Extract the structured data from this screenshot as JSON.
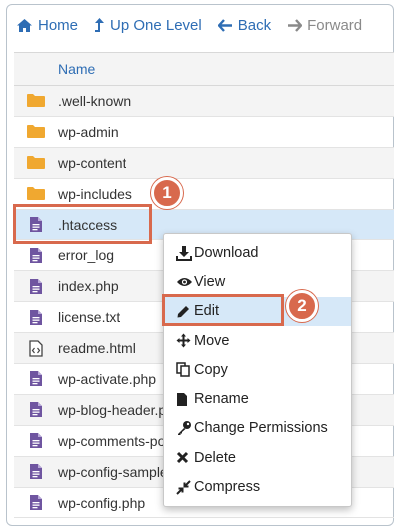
{
  "toolbar": {
    "buttons": [
      {
        "label": "Home",
        "icon": "home-icon"
      },
      {
        "label": "Up One Level",
        "icon": "level-up-icon"
      },
      {
        "label": "Back",
        "icon": "arrow-left-icon"
      },
      {
        "label": "Forward",
        "icon": "arrow-right-icon",
        "disabled": true
      }
    ]
  },
  "file_list": {
    "column_header": "Name",
    "rows": [
      {
        "name": ".well-known",
        "type": "folder"
      },
      {
        "name": "wp-admin",
        "type": "folder"
      },
      {
        "name": "wp-content",
        "type": "folder"
      },
      {
        "name": "wp-includes",
        "type": "folder"
      },
      {
        "name": ".htaccess",
        "type": "text",
        "selected": true
      },
      {
        "name": "error_log",
        "type": "text"
      },
      {
        "name": "index.php",
        "type": "text"
      },
      {
        "name": "license.txt",
        "type": "text"
      },
      {
        "name": "readme.html",
        "type": "code"
      },
      {
        "name": "wp-activate.php",
        "type": "text"
      },
      {
        "name": "wp-blog-header.php",
        "type": "text"
      },
      {
        "name": "wp-comments-post.php",
        "type": "text"
      },
      {
        "name": "wp-config-sample.php",
        "type": "text"
      },
      {
        "name": "wp-config.php",
        "type": "text"
      }
    ]
  },
  "context_menu": {
    "items": [
      {
        "label": "Download",
        "icon": "download-icon"
      },
      {
        "label": "View",
        "icon": "eye-icon"
      },
      {
        "label": "Edit",
        "icon": "pencil-icon",
        "active": true
      },
      {
        "label": "Move",
        "icon": "move-arrows-icon"
      },
      {
        "label": "Copy",
        "icon": "copy-icon"
      },
      {
        "label": "Rename",
        "icon": "file-icon"
      },
      {
        "label": "Change Permissions",
        "icon": "key-icon"
      },
      {
        "label": "Delete",
        "icon": "delete-x-icon"
      },
      {
        "label": "Compress",
        "icon": "compress-icon"
      }
    ]
  },
  "annotations": {
    "step1": "1",
    "step2": "2"
  },
  "colors": {
    "link_blue": "#2e6db4",
    "folder": "#f0a830",
    "file_purple": "#6f55a0",
    "selected_row": "#d6e8f8",
    "annotation": "#d8694d"
  }
}
